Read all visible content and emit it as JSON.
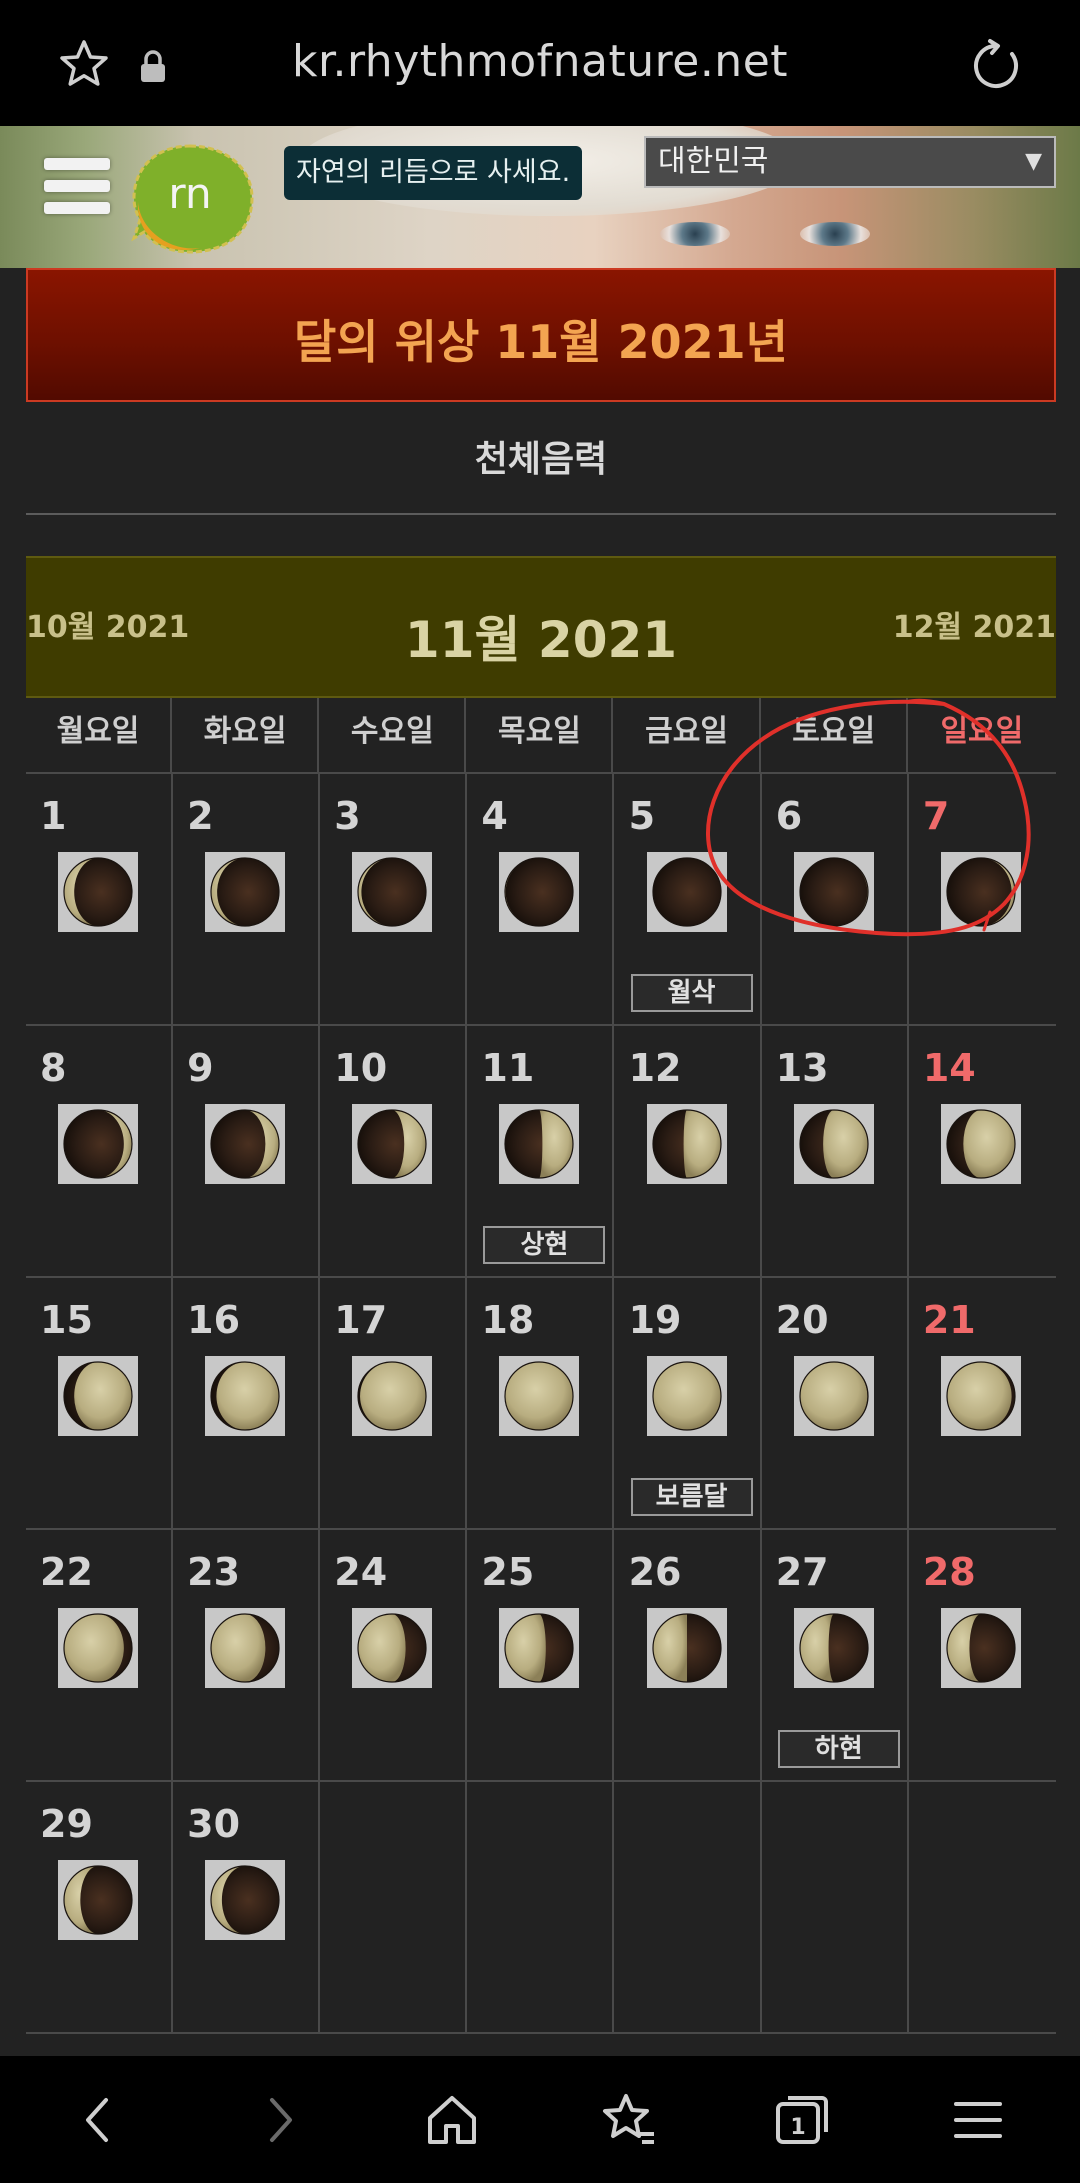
{
  "browser": {
    "url": "kr.rhythmofnature.net",
    "star_icon": "star-icon",
    "lock_icon": "lock-icon",
    "reload_icon": "reload-icon"
  },
  "banner": {
    "logo_text": "rn",
    "tagline": "자연의 리듬으로 사세요.",
    "country": "대한민국"
  },
  "page": {
    "title": "달의 위상 11월 2021년",
    "subtitle": "천체음력"
  },
  "month_nav": {
    "prev": "10월 2021",
    "current": "11월 2021",
    "next": "12월 2021"
  },
  "calendar": {
    "weekdays": [
      "월요일",
      "화요일",
      "수요일",
      "목요일",
      "금요일",
      "토요일",
      "일요일"
    ],
    "weeks": [
      [
        {
          "day": "1",
          "illum": 0.15,
          "waxing": false
        },
        {
          "day": "2",
          "illum": 0.09,
          "waxing": false
        },
        {
          "day": "3",
          "illum": 0.05,
          "waxing": false
        },
        {
          "day": "4",
          "illum": 0.01,
          "waxing": false
        },
        {
          "day": "5",
          "illum": 0.0,
          "waxing": true,
          "phase": "월삭"
        },
        {
          "day": "6",
          "illum": 0.01,
          "waxing": true
        },
        {
          "day": "7",
          "illum": 0.05,
          "waxing": true,
          "sunday": true
        }
      ],
      [
        {
          "day": "8",
          "illum": 0.12,
          "waxing": true
        },
        {
          "day": "9",
          "illum": 0.2,
          "waxing": true
        },
        {
          "day": "10",
          "illum": 0.32,
          "waxing": true
        },
        {
          "day": "11",
          "illum": 0.45,
          "waxing": true,
          "phase": "상현"
        },
        {
          "day": "12",
          "illum": 0.55,
          "waxing": true
        },
        {
          "day": "13",
          "illum": 0.66,
          "waxing": true
        },
        {
          "day": "14",
          "illum": 0.76,
          "waxing": true,
          "sunday": true
        }
      ],
      [
        {
          "day": "15",
          "illum": 0.85,
          "waxing": true
        },
        {
          "day": "16",
          "illum": 0.92,
          "waxing": true
        },
        {
          "day": "17",
          "illum": 0.97,
          "waxing": true
        },
        {
          "day": "18",
          "illum": 1.0,
          "waxing": true
        },
        {
          "day": "19",
          "illum": 1.0,
          "waxing": false,
          "phase": "보름달"
        },
        {
          "day": "20",
          "illum": 0.99,
          "waxing": false
        },
        {
          "day": "21",
          "illum": 0.95,
          "waxing": false,
          "sunday": true
        }
      ],
      [
        {
          "day": "22",
          "illum": 0.88,
          "waxing": false
        },
        {
          "day": "23",
          "illum": 0.8,
          "waxing": false
        },
        {
          "day": "24",
          "illum": 0.7,
          "waxing": false
        },
        {
          "day": "25",
          "illum": 0.6,
          "waxing": false
        },
        {
          "day": "26",
          "illum": 0.5,
          "waxing": false
        },
        {
          "day": "27",
          "illum": 0.42,
          "waxing": false,
          "phase": "하현"
        },
        {
          "day": "28",
          "illum": 0.33,
          "waxing": false,
          "sunday": true
        }
      ],
      [
        {
          "day": "29",
          "illum": 0.24,
          "waxing": false
        },
        {
          "day": "30",
          "illum": 0.16,
          "waxing": false
        }
      ]
    ]
  },
  "colors": {
    "sunday": "#f06a6a",
    "title_text": "#f3a451",
    "annotation": "#e0302a"
  },
  "bottom_nav": [
    "back-icon",
    "forward-icon",
    "home-icon",
    "bookmarks-icon",
    "tabs-icon",
    "menu-icon"
  ],
  "bottom_nav_tab_count": "1"
}
